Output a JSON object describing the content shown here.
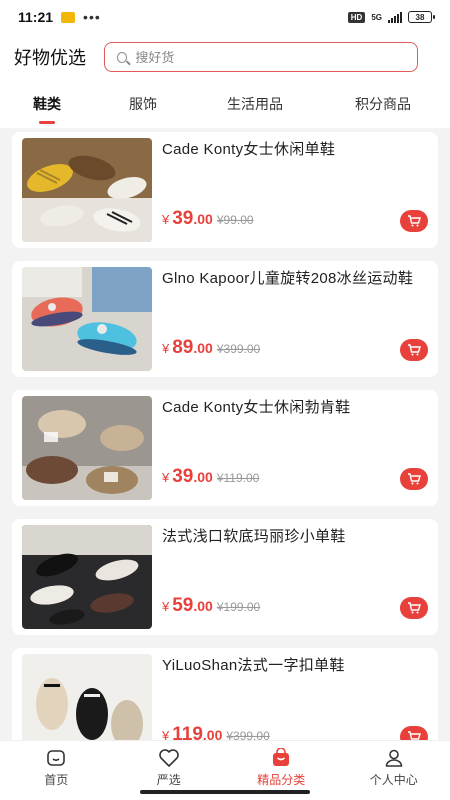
{
  "status": {
    "time": "11:21",
    "dots": "•••",
    "hd": "HD",
    "network": "5G",
    "battery": "38"
  },
  "header": {
    "title": "好物优选",
    "search_placeholder": "搜好货"
  },
  "tabs": [
    {
      "label": "鞋类",
      "active": true
    },
    {
      "label": "服饰",
      "active": false
    },
    {
      "label": "生活用品",
      "active": false
    },
    {
      "label": "积分商品",
      "active": false
    }
  ],
  "products": [
    {
      "name": "Cade Konty女士休闲单鞋",
      "price_symbol": "¥",
      "price_int": "39",
      "price_dec": ".00",
      "original_price": "¥99.00"
    },
    {
      "name": "Glno Kapoor儿童旋转208冰丝运动鞋",
      "price_symbol": "¥",
      "price_int": "89",
      "price_dec": ".00",
      "original_price": "¥399.00"
    },
    {
      "name": "Cade Konty女士休闲勃肯鞋",
      "price_symbol": "¥",
      "price_int": "39",
      "price_dec": ".00",
      "original_price": "¥119.00"
    },
    {
      "name": "法式浅口软底玛丽珍小单鞋",
      "price_symbol": "¥",
      "price_int": "59",
      "price_dec": ".00",
      "original_price": "¥199.00"
    },
    {
      "name": "YiLuoShan法式一字扣单鞋",
      "price_symbol": "¥",
      "price_int": "119",
      "price_dec": ".00",
      "original_price": "¥399.00"
    }
  ],
  "bottom_nav": [
    {
      "label": "首页",
      "icon": "home-icon",
      "active": false
    },
    {
      "label": "严选",
      "icon": "heart-icon",
      "active": false
    },
    {
      "label": "精品分类",
      "icon": "shopping-bag-icon",
      "active": true
    },
    {
      "label": "个人中心",
      "icon": "user-icon",
      "active": false
    }
  ],
  "colors": {
    "accent": "#e8403a",
    "background": "#f3f3f3"
  }
}
